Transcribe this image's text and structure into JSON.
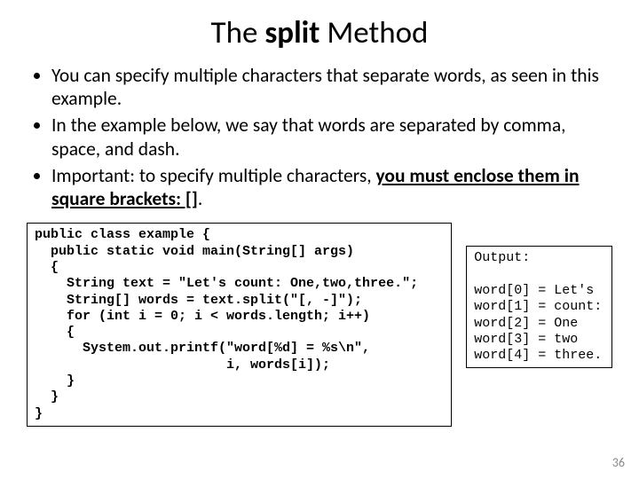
{
  "title": {
    "pre": "The ",
    "bold": "split",
    "post": " Method"
  },
  "bullets": {
    "b1": "You can specify multiple characters that separate words, as seen in this example.",
    "b2": "In the example below, we say that words are separated by comma, space, and dash.",
    "b3_pre": "Important: to specify multiple characters, ",
    "b3_u": "you must enclose them in square brackets: []",
    "b3_post": "."
  },
  "code": {
    "l0": "public class example {",
    "l1": "  public static void main(String[] args)",
    "l2": "  {",
    "l3": "    String text = \"Let's count: One,two,three.\";",
    "l4": "    String[] words = text.split(\"[, -]\");",
    "l5": "    for (int i = 0; i < words.length; i++)",
    "l6": "    {",
    "l7": "      System.out.printf(\"word[%d] = %s\\n\",",
    "l8": "                        i, words[i]);",
    "l9": "    }",
    "l10": "  }",
    "l11": "}"
  },
  "output": {
    "header": "Output:",
    "blank": "",
    "o0": "word[0] = Let's",
    "o1": "word[1] = count:",
    "o2": "word[2] = One",
    "o3": "word[3] = two",
    "o4": "word[4] = three."
  },
  "page_number": "36"
}
